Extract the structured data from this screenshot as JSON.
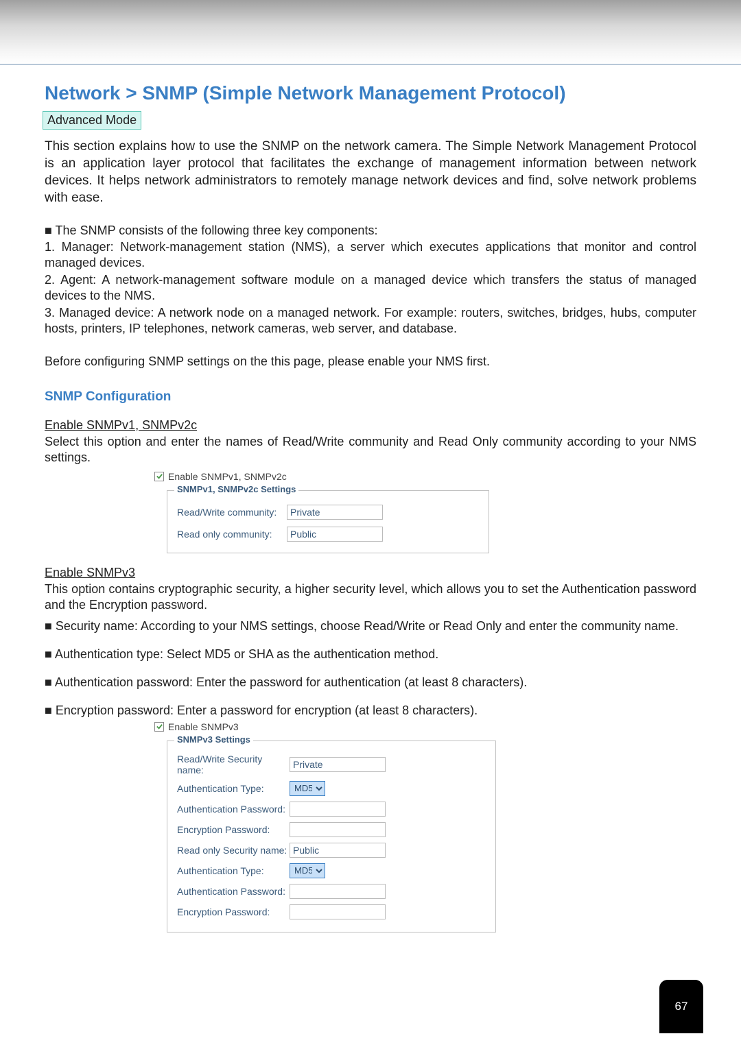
{
  "title": "Network > SNMP (Simple Network Management Protocol)",
  "mode_badge": "Advanced Mode",
  "intro": "This section explains how to use the SNMP on the network camera. The Simple Network Management Protocol is an application layer protocol that facilitates the exchange of management information between network devices. It helps network administrators to remotely manage network devices and find, solve network problems with ease.",
  "components_intro": "■ The SNMP consists of the following three key components:",
  "components": [
    "1. Manager: Network-management station (NMS), a server which executes applications that monitor and control managed devices.",
    "2. Agent: A network-management software module on a managed device which transfers the status of managed devices to the NMS.",
    "3. Managed device: A network node on a managed network. For example: routers, switches, bridges, hubs, computer hosts, printers, IP telephones, network cameras, web server, and database."
  ],
  "before_text": "Before configuring SNMP settings on the this page, please enable your NMS first.",
  "section_heading": "SNMP Configuration",
  "v1v2c": {
    "heading": "Enable SNMPv1, SNMPv2c",
    "desc": "Select this option and enter the names of Read/Write community and Read Only community according to your NMS settings.",
    "checkbox_label": "Enable SNMPv1, SNMPv2c",
    "legend": "SNMPv1, SNMPv2c Settings",
    "rw_label": "Read/Write community:",
    "rw_value": "Private",
    "ro_label": "Read only community:",
    "ro_value": "Public"
  },
  "v3": {
    "heading": "Enable SNMPv3",
    "desc": "This option contains cryptographic security, a higher security level, which allows you to set the Authentication password and the Encryption password.",
    "bullets": [
      "■ Security name: According to your NMS settings, choose Read/Write or Read Only and enter the community name.",
      "■ Authentication type: Select MD5 or SHA as the authentication method.",
      "■ Authentication password: Enter the password for authentication (at least 8 characters).",
      "■ Encryption password: Enter a password for encryption (at least 8 characters)."
    ],
    "checkbox_label": "Enable SNMPv3",
    "legend": "SNMPv3 Settings",
    "rw_sec_label": "Read/Write Security name:",
    "rw_sec_value": "Private",
    "auth_type_label": "Authentication Type:",
    "auth_type_value": "MD5",
    "auth_pw_label": "Authentication Password:",
    "enc_pw_label": "Encryption Password:",
    "ro_sec_label": "Read only Security name:",
    "ro_sec_value": "Public"
  },
  "page_number": "67"
}
